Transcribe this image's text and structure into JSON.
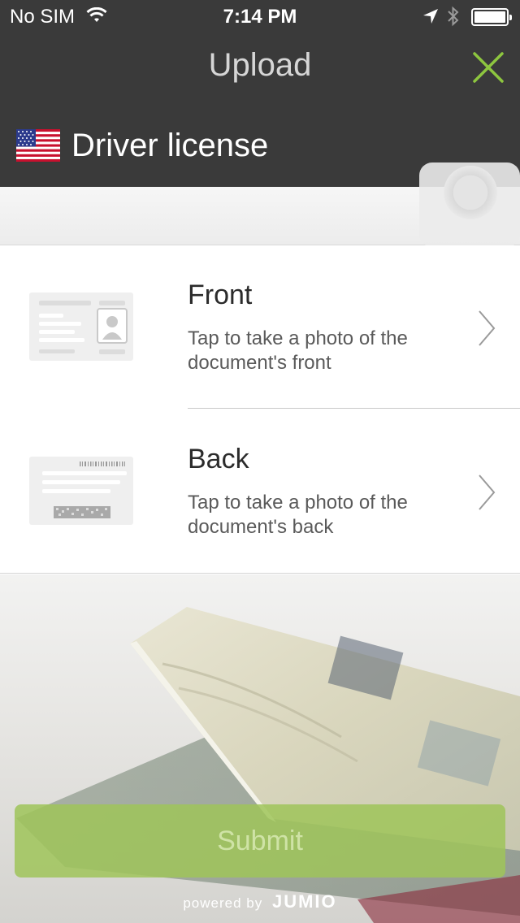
{
  "status_bar": {
    "carrier": "No SIM",
    "time": "7:14 PM",
    "icons": [
      "wifi-icon",
      "location-arrow-icon",
      "bluetooth-icon",
      "battery-icon"
    ]
  },
  "header": {
    "title": "Upload",
    "close_icon": "close-x-icon",
    "accent_color": "#8dc63f"
  },
  "document": {
    "country_flag": "us-flag-icon",
    "type": "Driver license"
  },
  "sides": [
    {
      "label": "Front",
      "description": "Tap to take a photo of the document's front"
    },
    {
      "label": "Back",
      "description": "Tap to take a photo of the document's back"
    }
  ],
  "actions": {
    "submit_label": "Submit",
    "submit_color": "#a8c96a"
  },
  "footer": {
    "powered_by": "powered by",
    "brand": "JUMIO"
  }
}
